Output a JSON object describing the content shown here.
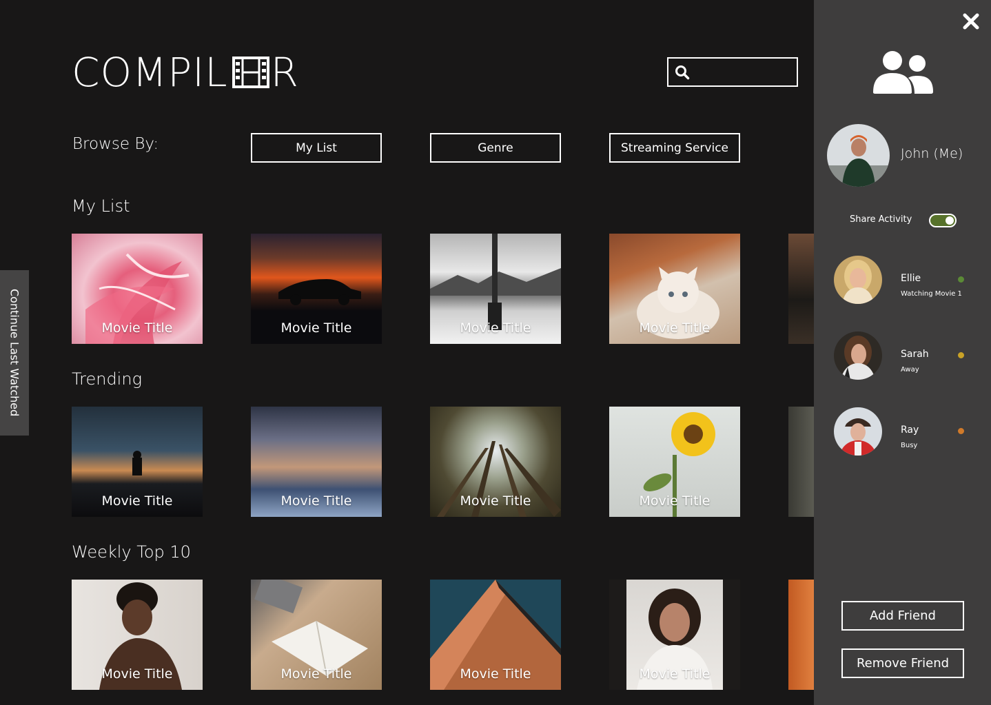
{
  "app": {
    "logo_left": "COMPIL",
    "logo_right": "R"
  },
  "search": {
    "placeholder": ""
  },
  "browse": {
    "label": "Browse By:",
    "buttons": [
      "My List",
      "Genre",
      "Streaming Service"
    ]
  },
  "sections": [
    {
      "title": "My List",
      "items": [
        "Movie Title",
        "Movie Title",
        "Movie Title",
        "Movie Title"
      ]
    },
    {
      "title": "Trending",
      "items": [
        "Movie Title",
        "Movie Title",
        "Movie Title",
        "Movie Title"
      ]
    },
    {
      "title": "Weekly Top 10",
      "items": [
        "Movie Title",
        "Movie Title",
        "Movie Title",
        "Movie Title"
      ]
    }
  ],
  "side_tab": {
    "label": "Continue Last Watched"
  },
  "panel": {
    "me": {
      "name": "John (Me)"
    },
    "share_activity": {
      "label": "Share Activity",
      "enabled": true
    },
    "friends": [
      {
        "name": "Ellie",
        "status": "Watching Movie 1",
        "status_color": "#5b8a36"
      },
      {
        "name": "Sarah",
        "status": "Away",
        "status_color": "#c9a227"
      },
      {
        "name": "Ray",
        "status": "Busy",
        "status_color": "#d07a2a"
      }
    ],
    "add_friend": "Add Friend",
    "remove_friend": "Remove Friend"
  },
  "colors": {
    "background": "#181717",
    "panel": "#3e3d3d",
    "side_tab": "#454444",
    "toggle_on": "#57722b"
  }
}
